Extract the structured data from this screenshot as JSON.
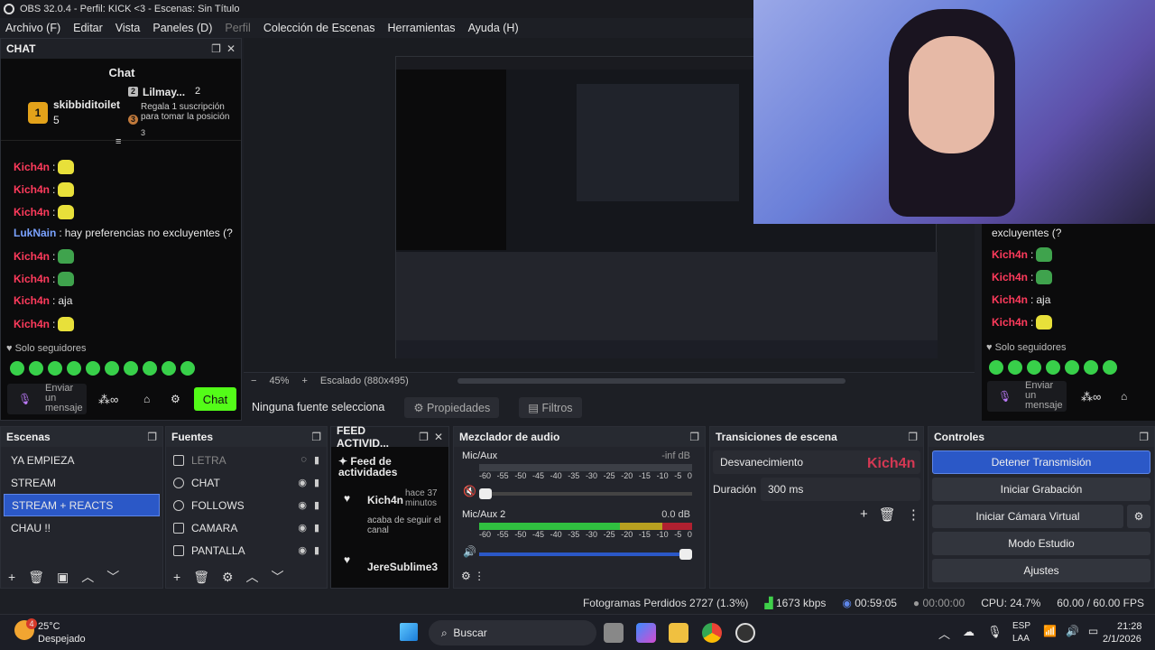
{
  "window": {
    "title": "OBS 32.0.4 - Perfil: KICK <3 - Escenas: Sin Título"
  },
  "menu": [
    "Archivo (F)",
    "Editar",
    "Vista",
    "Paneles (D)",
    "Perfil",
    "Colección de Escenas",
    "Herramientas",
    "Ayuda (H)"
  ],
  "chat": {
    "dock_title": "CHAT",
    "header": "Chat",
    "gift_user": "skibbiditoilet",
    "gift_count": "5",
    "gift_rank": "1",
    "gifter2_name": "Lilmay...",
    "gifter2_count": "2",
    "gifter2_rank": "2",
    "gifter3_rank": "3",
    "gift_message": "Regala 1 suscripción para tomar la posición",
    "gift_message_extra": "3",
    "messages": [
      {
        "user": "Kich4n",
        "text": "",
        "emote": "yellow"
      },
      {
        "user": "Kich4n",
        "text": "",
        "emote": "yellow"
      },
      {
        "user": "Kich4n",
        "text": "",
        "emote": "yellow"
      },
      {
        "user": "LukNain",
        "text": "hay preferencias no excluyentes (?",
        "emote": ""
      },
      {
        "user": "Kich4n",
        "text": "",
        "emote": "green"
      },
      {
        "user": "Kich4n",
        "text": "",
        "emote": "green"
      },
      {
        "user": "Kich4n",
        "text": "aja",
        "emote": ""
      },
      {
        "user": "Kich4n",
        "text": "",
        "emote": "yellow"
      }
    ],
    "followers_only": "Solo seguidores",
    "input_placeholder": "Enviar un mensaje",
    "send_label": "Chat"
  },
  "right_chat": {
    "line": "excluyentes (?",
    "messages": [
      {
        "user": "Kich4n",
        "text": ""
      },
      {
        "user": "Kich4n",
        "text": ""
      },
      {
        "user": "Kich4n",
        "text": "aja"
      },
      {
        "user": "Kich4n",
        "text": ""
      }
    ],
    "followers_only": "Solo seguidores",
    "input_placeholder": "Enviar un mensaje"
  },
  "preview": {
    "zoom": "45%",
    "scaling": "Escalado (880x495)",
    "no_source": "Ninguna fuente selecciona",
    "properties": "Propiedades",
    "filters": "Filtros"
  },
  "scenes": {
    "title": "Escenas",
    "items": [
      "YA EMPIEZA",
      "STREAM",
      "STREAM + REACTS",
      "CHAU !!"
    ],
    "selected": 2
  },
  "sources": {
    "title": "Fuentes",
    "items": [
      {
        "label": "LETRA",
        "dim": true
      },
      {
        "label": "CHAT",
        "dim": false
      },
      {
        "label": "FOLLOWS",
        "dim": false
      },
      {
        "label": "CAMARA",
        "dim": false
      },
      {
        "label": "PANTALLA",
        "dim": false
      }
    ]
  },
  "feed": {
    "title": "FEED ACTIVID...",
    "header": "Feed de actividades",
    "entries": [
      {
        "user": "Kich4n",
        "time": "hace 37 minutos",
        "action": "acaba de seguir el canal"
      },
      {
        "user": "JereSublime3",
        "time": "",
        "action": ""
      }
    ]
  },
  "mixer": {
    "title": "Mezclador de audio",
    "tracks": [
      {
        "name": "Mic/Aux",
        "level": "-inf dB",
        "fill": 0
      },
      {
        "name": "Mic/Aux 2",
        "level": "0.0 dB",
        "fill": 1
      }
    ],
    "ticks": [
      "-60",
      "-55",
      "-50",
      "-45",
      "-40",
      "-35",
      "-30",
      "-25",
      "-20",
      "-15",
      "-10",
      "-5",
      "0"
    ]
  },
  "transitions": {
    "title": "Transiciones de escena",
    "type": "Desvanecimiento",
    "duration_label": "Duración",
    "duration": "300 ms",
    "overlay_user": "Kich4n"
  },
  "controls": {
    "title": "Controles",
    "buttons": [
      "Detener Transmisión",
      "Iniciar Grabación",
      "Iniciar Cámara Virtual",
      "Modo Estudio",
      "Ajustes"
    ]
  },
  "status": {
    "dropped": "Fotogramas Perdidos 2727 (1.3%)",
    "bitrate": "1673 kbps",
    "live_time": "00:59:05",
    "rec_time": "00:00:00",
    "cpu": "CPU: 24.7%",
    "fps": "60.00 / 60.00 FPS"
  },
  "taskbar": {
    "temp": "25°C",
    "weather": "Despejado",
    "weather_badge": "4",
    "search": "Buscar",
    "lang1": "ESP",
    "lang2": "LAA",
    "time": "21:28",
    "date": "2/1/2026"
  },
  "colors": {
    "accent": "#2b58c7",
    "kick_green": "#53fc18",
    "username_red": "#ff3b5c"
  }
}
